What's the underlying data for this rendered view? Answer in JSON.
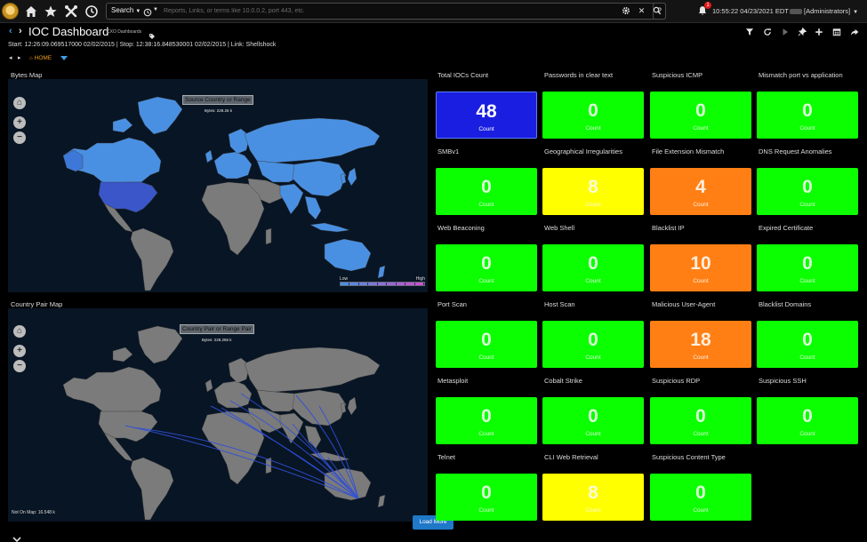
{
  "topbar": {
    "search_label": "Search",
    "search_placeholder": "Reports, Links, or terms like 10.0.0.2, port 443, etc.",
    "help_label": "?",
    "notification_count": "1",
    "clock": "10:55:22 04/23/2021 EDT",
    "user": "[Administrators]"
  },
  "header": {
    "title": "IOC Dashboard",
    "tag": "CXO Dashboards",
    "timerange": "Start: 12:26:09.069517000 02/02/2015 | Stop: 12:38:16.848530001 02/02/2015 | Link: Shellshock",
    "home_label": "HOME"
  },
  "bytes_map": {
    "title": "Bytes Map",
    "tooltip": "Source Country or Range",
    "tooltip_value": "Bytes: 228.26 k",
    "legend_low": "Low",
    "legend_high": "High"
  },
  "pair_map": {
    "title": "Country Pair Map",
    "tooltip": "Country Pair or Range Pair",
    "tooltip_value": "Bytes: 228.255 k",
    "not_on_map": "Not On Map: 16.548 k"
  },
  "load_more": "Load More",
  "tiles": [
    {
      "title": "Total IOCs Count",
      "value": "48",
      "label": "Count",
      "color": "blue"
    },
    {
      "title": "Passwords in clear text",
      "value": "0",
      "label": "Count",
      "color": "green"
    },
    {
      "title": "Suspicious ICMP",
      "value": "0",
      "label": "Count",
      "color": "green"
    },
    {
      "title": "Mismatch port vs application",
      "value": "0",
      "label": "Count",
      "color": "green"
    },
    {
      "title": "SMBv1",
      "value": "0",
      "label": "Count",
      "color": "green"
    },
    {
      "title": "Geographical Irregularities",
      "value": "8",
      "label": "Count",
      "color": "yellow"
    },
    {
      "title": "File Extension Mismatch",
      "value": "4",
      "label": "Count",
      "color": "orange"
    },
    {
      "title": "DNS Request Anomalies",
      "value": "0",
      "label": "Count",
      "color": "green"
    },
    {
      "title": "Web Beaconing",
      "value": "0",
      "label": "Count",
      "color": "green"
    },
    {
      "title": "Web Shell",
      "value": "0",
      "label": "Count",
      "color": "green"
    },
    {
      "title": "Blacklist IP",
      "value": "10",
      "label": "Count",
      "color": "orange"
    },
    {
      "title": "Expired Certificate",
      "value": "0",
      "label": "Count",
      "color": "green"
    },
    {
      "title": "Port Scan",
      "value": "0",
      "label": "Count",
      "color": "green"
    },
    {
      "title": "Host Scan",
      "value": "0",
      "label": "Count",
      "color": "green"
    },
    {
      "title": "Malicious User-Agent",
      "value": "18",
      "label": "Count",
      "color": "orange"
    },
    {
      "title": "Blacklist Domains",
      "value": "0",
      "label": "Count",
      "color": "green"
    },
    {
      "title": "Metasploit",
      "value": "0",
      "label": "Count",
      "color": "green"
    },
    {
      "title": "Cobalt Strike",
      "value": "0",
      "label": "Count",
      "color": "green"
    },
    {
      "title": "Suspicious RDP",
      "value": "0",
      "label": "Count",
      "color": "green"
    },
    {
      "title": "Suspicious SSH",
      "value": "0",
      "label": "Count",
      "color": "green"
    },
    {
      "title": "Telnet",
      "value": "0",
      "label": "Count",
      "color": "green"
    },
    {
      "title": "CLI Web Retrieval",
      "value": "8",
      "label": "Count",
      "color": "yellow"
    },
    {
      "title": "Suspicious Content Type",
      "value": "0",
      "label": "Count",
      "color": "green"
    }
  ],
  "colors": {
    "green": "#0bff01",
    "yellow": "#ffff00",
    "orange": "#ff7f14",
    "blue": "#1a1ee0",
    "accent": "#f29d1a"
  }
}
